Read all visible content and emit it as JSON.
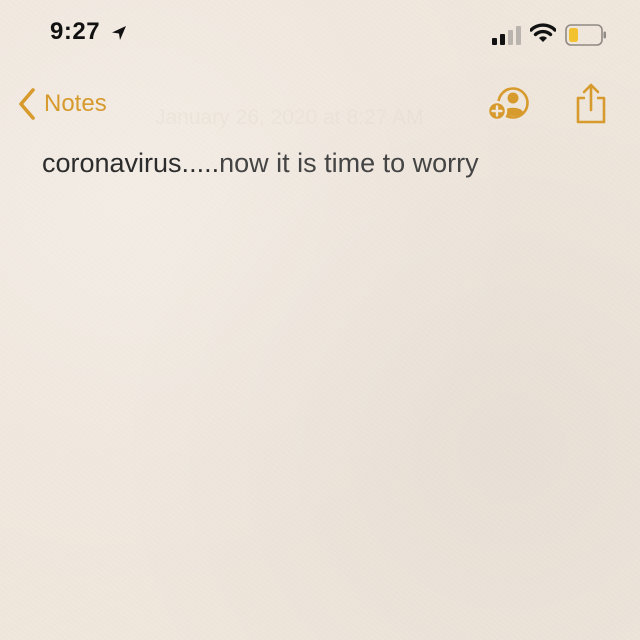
{
  "status_bar": {
    "time": "9:27",
    "location_icon": "location-arrow-icon",
    "signal_icon": "cellular-signal-icon",
    "wifi_icon": "wifi-icon",
    "battery_icon": "battery-icon",
    "battery_level": 0.3,
    "battery_color": "#f2c230"
  },
  "nav": {
    "back_label": "Notes",
    "accent_color": "#d79a2c",
    "date_ghost": "January 26, 2020 at 8:27 AM",
    "add_person_icon": "add-person-icon",
    "share_icon": "share-icon"
  },
  "note": {
    "title_text": "coronavirus.....",
    "body_text": "now it is time to worry"
  }
}
